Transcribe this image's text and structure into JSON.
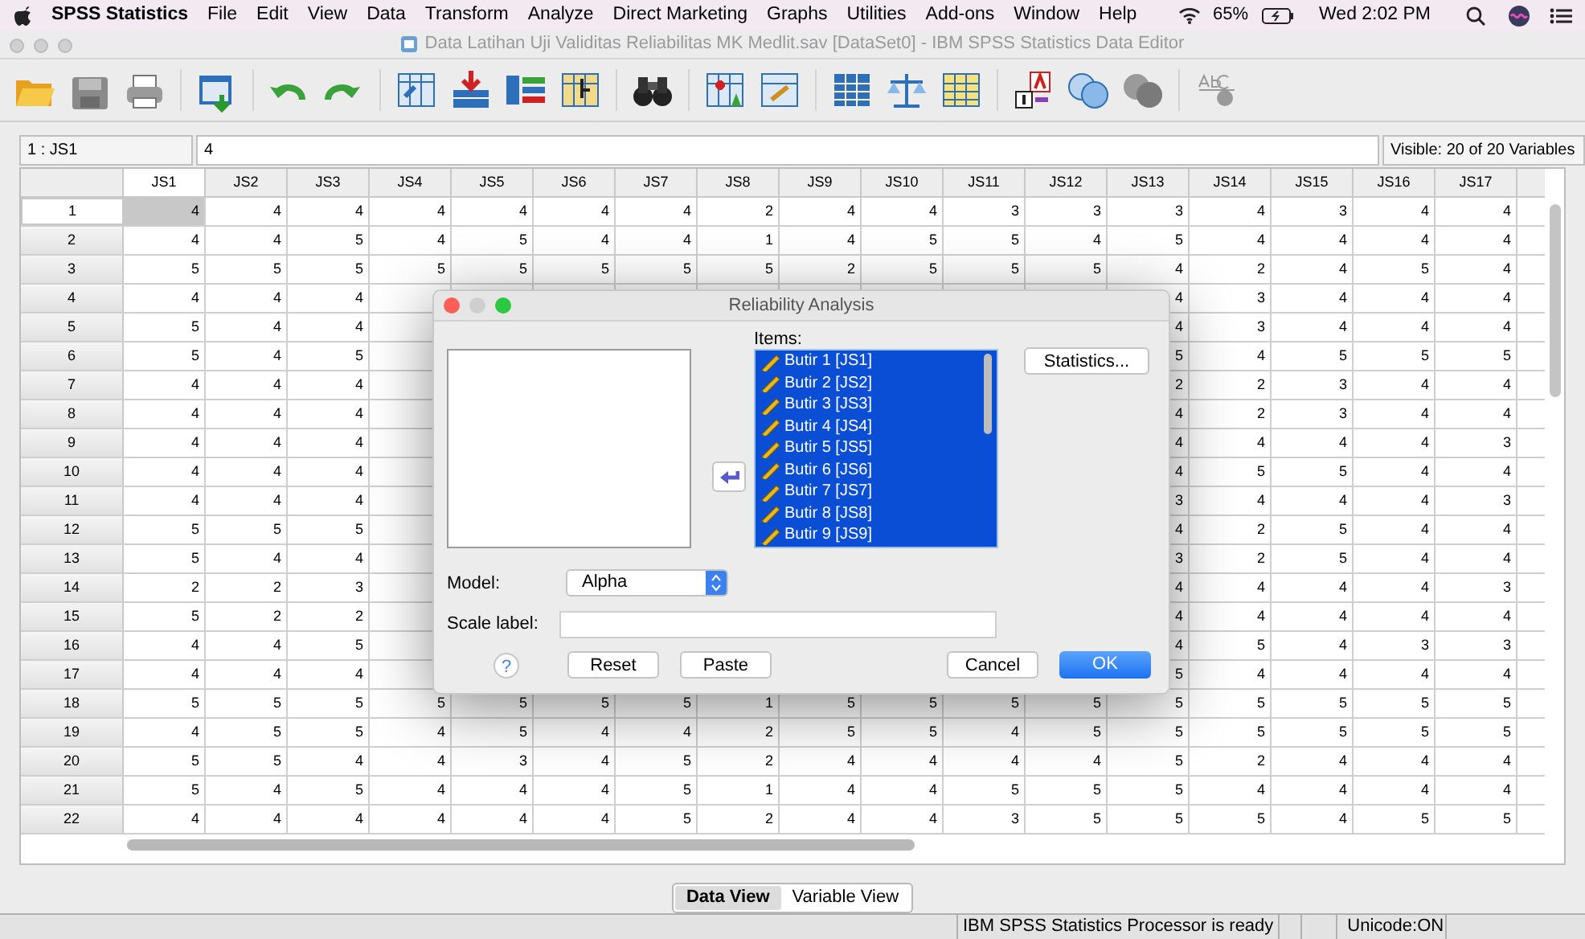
{
  "menubar": {
    "app": "SPSS Statistics",
    "menus": [
      "File",
      "Edit",
      "View",
      "Data",
      "Transform",
      "Analyze",
      "Direct Marketing",
      "Graphs",
      "Utilities",
      "Add-ons",
      "Window",
      "Help"
    ],
    "battery": "65%",
    "clock": "Wed 2:02 PM"
  },
  "window": {
    "title": "Data Latihan Uji Validitas Reliabilitas MK Medlit.sav [DataSet0] - IBM SPSS Statistics Data Editor"
  },
  "cell_editor": {
    "cell": "1 : JS1",
    "value": "4",
    "visible": "Visible: 20 of 20 Variables"
  },
  "grid": {
    "columns": [
      {
        "label": "JS1",
        "selected": true
      },
      {
        "label": "JS2",
        "selected": false
      },
      {
        "label": "JS3",
        "selected": false
      },
      {
        "label": "JS4",
        "selected": false
      },
      {
        "label": "JS5",
        "selected": false
      },
      {
        "label": "JS6",
        "selected": false
      },
      {
        "label": "JS7",
        "selected": false
      },
      {
        "label": "JS8",
        "selected": false
      },
      {
        "label": "JS9",
        "selected": false
      },
      {
        "label": "JS10",
        "selected": false
      },
      {
        "label": "JS11",
        "selected": false
      },
      {
        "label": "JS12",
        "selected": false
      },
      {
        "label": "JS13",
        "selected": false
      },
      {
        "label": "JS14",
        "selected": false
      },
      {
        "label": "JS15",
        "selected": false
      },
      {
        "label": "JS16",
        "selected": false
      },
      {
        "label": "JS17",
        "selected": false
      }
    ],
    "rows": [
      {
        "label": "1",
        "selected": true,
        "cells": [
          "4",
          "4",
          "4",
          "4",
          "4",
          "4",
          "4",
          "2",
          "4",
          "4",
          "3",
          "3",
          "3",
          "4",
          "3",
          "4",
          "4"
        ]
      },
      {
        "label": "2",
        "selected": false,
        "cells": [
          "4",
          "4",
          "5",
          "4",
          "5",
          "4",
          "4",
          "1",
          "4",
          "5",
          "5",
          "4",
          "5",
          "4",
          "4",
          "4",
          "4"
        ]
      },
      {
        "label": "3",
        "selected": false,
        "cells": [
          "5",
          "5",
          "5",
          "5",
          "5",
          "5",
          "5",
          "5",
          "2",
          "5",
          "5",
          "5",
          "4",
          "2",
          "4",
          "5",
          "4"
        ]
      },
      {
        "label": "4",
        "selected": false,
        "cells": [
          "4",
          "4",
          "4",
          null,
          null,
          null,
          null,
          null,
          null,
          null,
          null,
          null,
          "4",
          "3",
          "4",
          "4",
          "4"
        ]
      },
      {
        "label": "5",
        "selected": false,
        "cells": [
          "5",
          "4",
          "4",
          null,
          null,
          null,
          null,
          null,
          null,
          null,
          null,
          null,
          "4",
          "3",
          "4",
          "4",
          "4"
        ]
      },
      {
        "label": "6",
        "selected": false,
        "cells": [
          "5",
          "4",
          "5",
          null,
          null,
          null,
          null,
          null,
          null,
          null,
          null,
          null,
          "5",
          "4",
          "5",
          "5",
          "5"
        ]
      },
      {
        "label": "7",
        "selected": false,
        "cells": [
          "4",
          "4",
          "4",
          null,
          null,
          null,
          null,
          null,
          null,
          null,
          null,
          null,
          "2",
          "2",
          "3",
          "4",
          "4"
        ]
      },
      {
        "label": "8",
        "selected": false,
        "cells": [
          "4",
          "4",
          "4",
          null,
          null,
          null,
          null,
          null,
          null,
          null,
          null,
          null,
          "4",
          "2",
          "3",
          "4",
          "4"
        ]
      },
      {
        "label": "9",
        "selected": false,
        "cells": [
          "4",
          "4",
          "4",
          null,
          null,
          null,
          null,
          null,
          null,
          null,
          null,
          null,
          "4",
          "4",
          "4",
          "4",
          "3"
        ]
      },
      {
        "label": "10",
        "selected": false,
        "cells": [
          "4",
          "4",
          "4",
          null,
          null,
          null,
          null,
          null,
          null,
          null,
          null,
          null,
          "4",
          "5",
          "5",
          "4",
          "4"
        ]
      },
      {
        "label": "11",
        "selected": false,
        "cells": [
          "4",
          "4",
          "4",
          null,
          null,
          null,
          null,
          null,
          null,
          null,
          null,
          null,
          "3",
          "4",
          "4",
          "4",
          "3"
        ]
      },
      {
        "label": "12",
        "selected": false,
        "cells": [
          "5",
          "5",
          "5",
          null,
          null,
          null,
          null,
          null,
          null,
          null,
          null,
          null,
          "4",
          "2",
          "5",
          "4",
          "4"
        ]
      },
      {
        "label": "13",
        "selected": false,
        "cells": [
          "5",
          "4",
          "4",
          null,
          null,
          null,
          null,
          null,
          null,
          null,
          null,
          null,
          "3",
          "2",
          "5",
          "4",
          "4"
        ]
      },
      {
        "label": "14",
        "selected": false,
        "cells": [
          "2",
          "2",
          "3",
          null,
          null,
          null,
          null,
          null,
          null,
          null,
          null,
          null,
          "4",
          "4",
          "4",
          "4",
          "3"
        ]
      },
      {
        "label": "15",
        "selected": false,
        "cells": [
          "5",
          "2",
          "2",
          null,
          null,
          null,
          null,
          null,
          null,
          null,
          null,
          null,
          "4",
          "4",
          "4",
          "4",
          "4"
        ]
      },
      {
        "label": "16",
        "selected": false,
        "cells": [
          "4",
          "4",
          "5",
          null,
          null,
          null,
          null,
          null,
          null,
          null,
          null,
          null,
          "4",
          "5",
          "4",
          "3",
          "3"
        ]
      },
      {
        "label": "17",
        "selected": false,
        "cells": [
          "4",
          "4",
          "4",
          null,
          null,
          null,
          null,
          null,
          null,
          null,
          null,
          null,
          "5",
          "4",
          "4",
          "4",
          "4"
        ]
      },
      {
        "label": "18",
        "selected": false,
        "cells": [
          "5",
          "5",
          "5",
          "5",
          "5",
          "5",
          "5",
          "1",
          "5",
          "5",
          "5",
          "5",
          "5",
          "5",
          "5",
          "5",
          "5"
        ]
      },
      {
        "label": "19",
        "selected": false,
        "cells": [
          "4",
          "5",
          "5",
          "4",
          "5",
          "4",
          "4",
          "2",
          "5",
          "5",
          "4",
          "5",
          "5",
          "5",
          "5",
          "5",
          "5"
        ]
      },
      {
        "label": "20",
        "selected": false,
        "cells": [
          "5",
          "5",
          "4",
          "4",
          "3",
          "4",
          "5",
          "2",
          "4",
          "4",
          "4",
          "4",
          "5",
          "2",
          "4",
          "4",
          "4"
        ]
      },
      {
        "label": "21",
        "selected": false,
        "cells": [
          "5",
          "4",
          "5",
          "4",
          "4",
          "4",
          "5",
          "1",
          "4",
          "4",
          "5",
          "5",
          "5",
          "4",
          "4",
          "4",
          "4"
        ]
      },
      {
        "label": "22",
        "selected": false,
        "cells": [
          "4",
          "4",
          "4",
          "4",
          "4",
          "4",
          "5",
          "2",
          "4",
          "4",
          "3",
          "5",
          "5",
          "5",
          "4",
          "5",
          "5"
        ]
      }
    ]
  },
  "dialog": {
    "title": "Reliability Analysis",
    "items_label": "Items:",
    "items": [
      {
        "label": "Butir 1 [JS1]",
        "selected": true
      },
      {
        "label": "Butir 2 [JS2]",
        "selected": true
      },
      {
        "label": "Butir 3 [JS3]",
        "selected": true
      },
      {
        "label": "Butir 4 [JS4]",
        "selected": true
      },
      {
        "label": "Butir 5 [JS5]",
        "selected": true
      },
      {
        "label": "Butir 6 [JS6]",
        "selected": true
      },
      {
        "label": "Butir 7 [JS7]",
        "selected": true
      },
      {
        "label": "Butir 8 [JS8]",
        "selected": true
      },
      {
        "label": "Butir 9 [JS9]",
        "selected": true
      }
    ],
    "statistics_button": "Statistics...",
    "model_label": "Model:",
    "model": "Alpha",
    "scale_label": "Scale label:",
    "buttons": [
      {
        "kind": "help",
        "label": "?"
      },
      {
        "kind": "normal",
        "label": "Reset"
      },
      {
        "kind": "normal",
        "label": "Paste"
      },
      {
        "kind": "spacer-normal",
        "label": "Cancel"
      },
      {
        "kind": "default",
        "label": "OK"
      }
    ]
  },
  "view_tabs": [
    {
      "label": "Data View",
      "selected": true
    },
    {
      "label": "Variable View",
      "selected": false
    }
  ],
  "status_bar": {
    "message": "IBM SPSS Statistics Processor is ready",
    "encoding": "Unicode:ON"
  }
}
